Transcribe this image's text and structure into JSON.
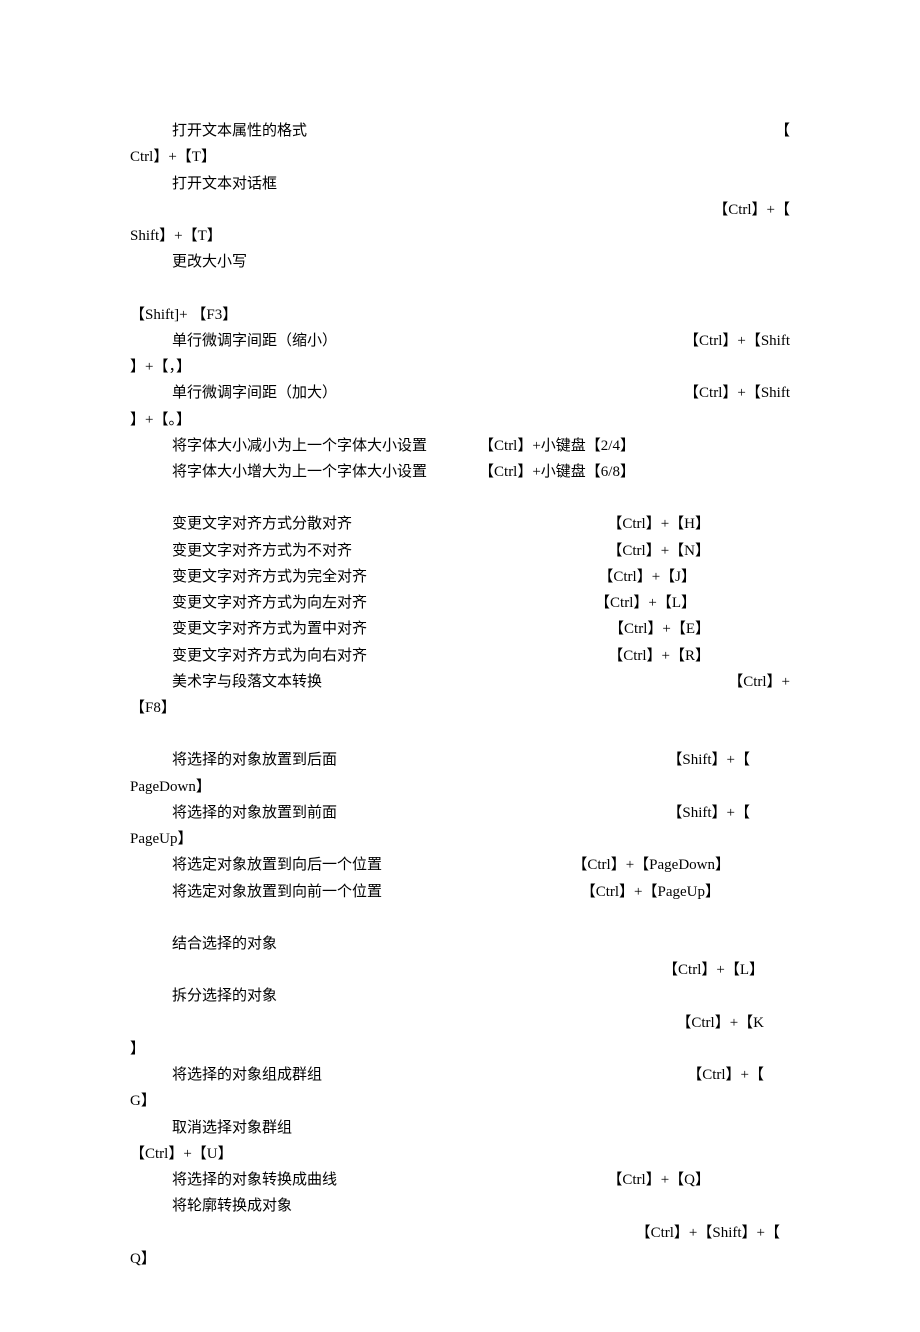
{
  "lines": [
    {
      "type": "row",
      "leftClass": "desc-indent",
      "left": "打开文本属性的格式",
      "right": "【"
    },
    {
      "type": "plain",
      "text": "Ctrl】+【T】"
    },
    {
      "type": "plain",
      "class": "desc-indent",
      "text": "打开文本对话框"
    },
    {
      "type": "right",
      "text": "【Ctrl】+【"
    },
    {
      "type": "plain",
      "text": "Shift】+【T】"
    },
    {
      "type": "plain",
      "class": "desc-indent",
      "text": "更改大小写"
    },
    {
      "type": "blank"
    },
    {
      "type": "plain",
      "text": "【Shift]+ 【F3】"
    },
    {
      "type": "row",
      "leftClass": "desc-indent",
      "left": "单行微调字间距（缩小）",
      "right": "【Ctrl】+【Shift"
    },
    {
      "type": "plain",
      "text": "】+【，】"
    },
    {
      "type": "row",
      "leftClass": "desc-indent",
      "left": "单行微调字间距（加大）",
      "right": "【Ctrl】+【Shift"
    },
    {
      "type": "plain",
      "text": "】+【。】"
    },
    {
      "type": "pair",
      "left": "将字体大小减小为上一个字体大小设置",
      "right": "【Ctrl】+小键盘【2/4】"
    },
    {
      "type": "pair",
      "left": "将字体大小增大为上一个字体大小设置",
      "right": "【Ctrl】+小键盘【6/8】"
    },
    {
      "type": "blank"
    },
    {
      "type": "row",
      "leftClass": "desc-indent",
      "left": "变更文字对齐方式分散对齐",
      "rightPadRight": 80,
      "right": "【Ctrl】+【H】"
    },
    {
      "type": "row",
      "leftClass": "desc-indent",
      "left": "变更文字对齐方式为不对齐",
      "rightPadRight": 80,
      "right": "【Ctrl】+【N】"
    },
    {
      "type": "row",
      "leftClass": "desc-indent",
      "left": "变更文字对齐方式为完全对齐",
      "rightPadRight": 94,
      "right": "【Ctrl】+【J】"
    },
    {
      "type": "row",
      "leftClass": "desc-indent",
      "left": "变更文字对齐方式为向左对齐",
      "rightPadRight": 94,
      "right": "【Ctrl】+【L】"
    },
    {
      "type": "row",
      "leftClass": "desc-indent",
      "left": "变更文字对齐方式为置中对齐",
      "rightPadRight": 80,
      "right": "【Ctrl】+【E】"
    },
    {
      "type": "row",
      "leftClass": "desc-indent",
      "left": "变更文字对齐方式为向右对齐",
      "rightPadRight": 80,
      "right": "【Ctrl】+【R】"
    },
    {
      "type": "row",
      "leftClass": "desc-indent",
      "left": "美术字与段落文本转换",
      "right": "【Ctrl】+"
    },
    {
      "type": "plain",
      "text": "【F8】"
    },
    {
      "type": "blank"
    },
    {
      "type": "row",
      "leftClass": "desc-indent",
      "left": "将选择的对象放置到后面",
      "rightPadRight": 40,
      "right": "【Shift】+【"
    },
    {
      "type": "plain",
      "text": "PageDown】"
    },
    {
      "type": "row",
      "leftClass": "desc-indent",
      "left": "将选择的对象放置到前面",
      "rightPadRight": 40,
      "right": "【Shift】+【"
    },
    {
      "type": "plain",
      "text": "PageUp】"
    },
    {
      "type": "row",
      "leftClass": "desc-indent",
      "left": "将选定对象放置到向后一个位置",
      "rightPadRight": 60,
      "right": "【Ctrl】+【PageDown】"
    },
    {
      "type": "row",
      "leftClass": "desc-indent",
      "left": "将选定对象放置到向前一个位置",
      "rightPadRight": 70,
      "right": "【Ctrl】+【PageUp】"
    },
    {
      "type": "blank"
    },
    {
      "type": "plain",
      "class": "desc-indent",
      "text": "结合选择的对象"
    },
    {
      "type": "right",
      "padRight": 26,
      "text": "【Ctrl】+【L】"
    },
    {
      "type": "plain",
      "class": "desc-indent",
      "text": "拆分选择的对象"
    },
    {
      "type": "right",
      "padRight": 26,
      "text": "【Ctrl】+【K"
    },
    {
      "type": "plain",
      "text": "】"
    },
    {
      "type": "row",
      "leftClass": "desc-indent",
      "left": "将选择的对象组成群组",
      "rightPadRight": 26,
      "right": "【Ctrl】+【"
    },
    {
      "type": "plain",
      "text": "G】"
    },
    {
      "type": "plain",
      "class": "desc-indent",
      "text": "取消选择对象群组"
    },
    {
      "type": "plain",
      "text": "【Ctrl】+【U】"
    },
    {
      "type": "row",
      "leftClass": "desc-indent",
      "left": "将选择的对象转换成曲线",
      "rightPadRight": 80,
      "right": "【Ctrl】+【Q】"
    },
    {
      "type": "plain",
      "class": "desc-indent",
      "text": "将轮廓转换成对象"
    },
    {
      "type": "right",
      "padRight": 10,
      "text": "【Ctrl】+【Shift】+【"
    },
    {
      "type": "plain",
      "text": "Q】"
    }
  ]
}
